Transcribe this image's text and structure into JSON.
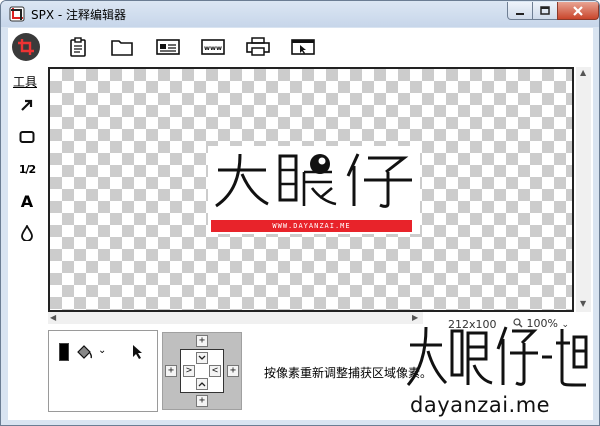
{
  "window": {
    "title": "SPX - 注释编辑器"
  },
  "toolbar": {
    "buttons": [
      {
        "icon": "crop-icon"
      },
      {
        "icon": "clipboard-icon"
      },
      {
        "icon": "folder-icon"
      },
      {
        "icon": "card-icon"
      },
      {
        "icon": "www-icon"
      },
      {
        "icon": "printer-icon"
      },
      {
        "icon": "window-icon"
      }
    ],
    "www_glyph": "www"
  },
  "tools": {
    "label": "工具",
    "items": [
      {
        "icon": "arrow-icon"
      },
      {
        "icon": "rectangle-icon"
      },
      {
        "icon": "number-icon",
        "glyph": "1/2"
      },
      {
        "icon": "text-icon",
        "glyph": "A"
      },
      {
        "icon": "blur-drop-icon"
      }
    ]
  },
  "canvas": {
    "image": {
      "logo_text": "大眼仔",
      "url_text": "WWW.DAYANZAI.ME",
      "accent": "#e8232a"
    }
  },
  "status": {
    "dimensions": "212x100",
    "zoom": "100%"
  },
  "bottom": {
    "color": "#000000",
    "hint": "按像素重新调整捕获区域像素。",
    "pad_plus": "+",
    "pad_left": "<",
    "pad_right": ">"
  },
  "watermark": {
    "logo_text": "大眼仔-旭",
    "url": "dayanzai.me"
  }
}
